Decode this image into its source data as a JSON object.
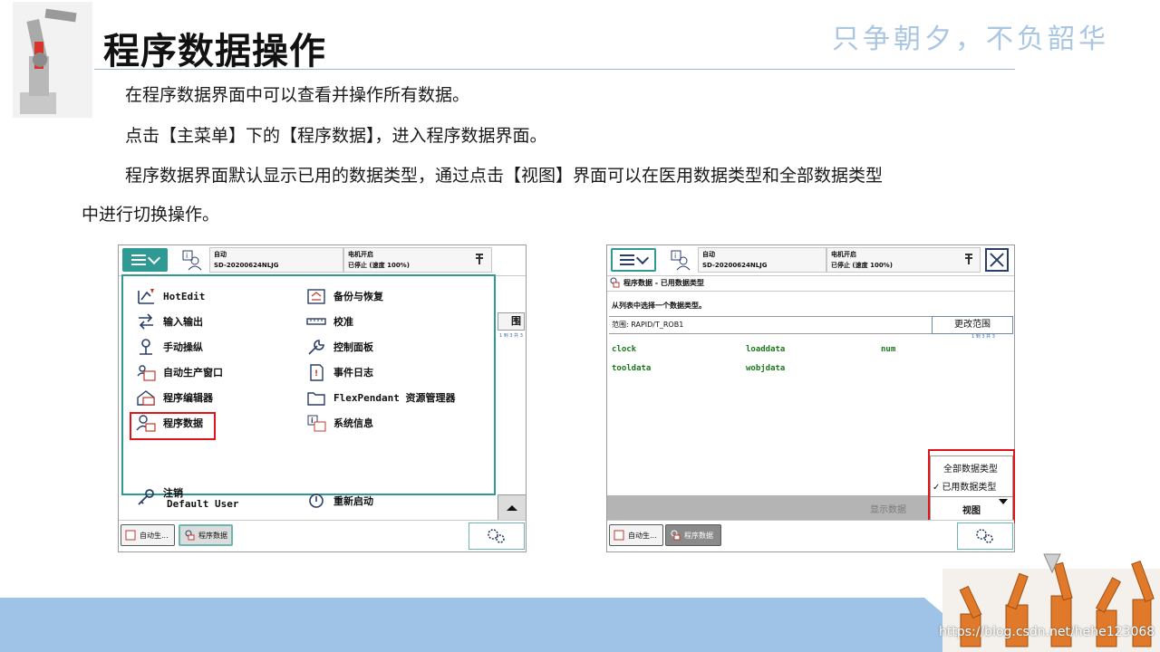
{
  "slide": {
    "title": "程序数据操作",
    "motto": "只争朝夕，不负韶华",
    "paragraphs": [
      "在程序数据界面中可以查看并操作所有数据。",
      "点击【主菜单】下的【程序数据】，进入程序数据界面。",
      "程序数据界面默认显示已用的数据类型，通过点击【视图】界面可以在医用数据类型和全部数据类型",
      "中进行切换操作。"
    ],
    "watermark": "https://blog.csdn.net/hehe123068"
  },
  "colors": {
    "teal": "#2f9a93",
    "navy": "#2a3e6a",
    "highlight": "#e0121c",
    "footer": "#9fc3e6",
    "data_green": "#1a7a1a"
  },
  "left_panel": {
    "status": {
      "mode": "自动",
      "controller": "SD-20200624NLJG",
      "motor": "电机开启",
      "state": "已停止 (速度 100%)"
    },
    "menu_left": [
      {
        "label": "HotEdit",
        "icon": "hotedit-icon"
      },
      {
        "label": "输入输出",
        "icon": "io-icon"
      },
      {
        "label": "手动操纵",
        "icon": "jog-icon"
      },
      {
        "label": "自动生产窗口",
        "icon": "auto-window-icon"
      },
      {
        "label": "程序编辑器",
        "icon": "editor-icon"
      },
      {
        "label": "程序数据",
        "icon": "program-data-icon"
      }
    ],
    "menu_right": [
      {
        "label": "备份与恢复",
        "icon": "backup-icon"
      },
      {
        "label": "校准",
        "icon": "calibration-icon"
      },
      {
        "label": "控制面板",
        "icon": "control-panel-icon"
      },
      {
        "label": "事件日志",
        "icon": "event-log-icon"
      },
      {
        "label": "FlexPendant 资源管理器",
        "icon": "explorer-icon"
      },
      {
        "label": "系统信息",
        "icon": "system-info-icon"
      }
    ],
    "logout": {
      "label": "注销",
      "user": "Default User"
    },
    "restart": "重新启动",
    "side_fragment": "围",
    "side_counter": "1 到 3 共 3",
    "taskbar": [
      {
        "label": "自动生..."
      },
      {
        "label": "程序数据"
      }
    ]
  },
  "right_panel": {
    "status": {
      "mode": "自动",
      "controller": "SD-20200624NLJG",
      "motor": "电机开启",
      "state": "已停止 (速度 100%)"
    },
    "breadcrumb": "程序数据 - 已用数据类型",
    "instruction": "从列表中选择一个数据类型。",
    "scope": "范围: RAPID/T_ROB1",
    "change_scope": "更改范围",
    "counter": "1 到 3 共 3",
    "data_types": [
      "clock",
      "loaddata",
      "num",
      "tooldata",
      "wobjdata"
    ],
    "view_options": [
      {
        "label": "全部数据类型",
        "checked": false
      },
      {
        "label": "已用数据类型",
        "checked": true
      }
    ],
    "check_mark": "✓",
    "show_data": "显示数据",
    "view_button": "视图",
    "taskbar": [
      {
        "label": "自动生..."
      },
      {
        "label": "程序数据"
      }
    ]
  }
}
